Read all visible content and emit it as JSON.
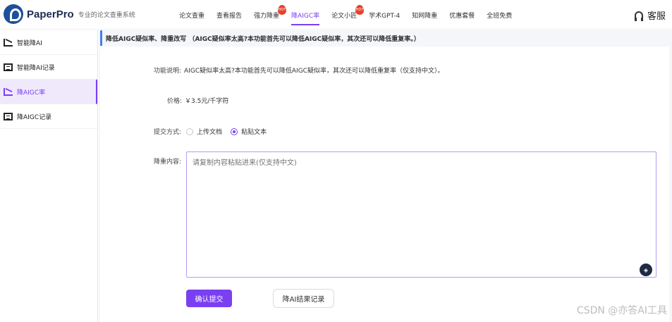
{
  "brand": {
    "name": "PaperPro",
    "slogan": "专业的论文查重系统"
  },
  "nav": {
    "items": [
      {
        "label": "论文查重",
        "hot": false,
        "active": false
      },
      {
        "label": "查看报告",
        "hot": false,
        "active": false
      },
      {
        "label": "强力降重",
        "hot": true,
        "active": false
      },
      {
        "label": "降AIGC率",
        "hot": false,
        "active": true
      },
      {
        "label": "论文小匠",
        "hot": true,
        "active": false
      },
      {
        "label": "学术GPT-4",
        "hot": false,
        "active": false
      },
      {
        "label": "知网降重",
        "hot": false,
        "active": false
      },
      {
        "label": "优惠套餐",
        "hot": false,
        "active": false
      },
      {
        "label": "全班免费",
        "hot": false,
        "active": false
      }
    ],
    "hot_badge": "HOT",
    "service_label": "客服"
  },
  "sidebar": {
    "items": [
      {
        "label": "智能降AI",
        "icon": "chart-icon",
        "active": false
      },
      {
        "label": "智能降AI记录",
        "icon": "document-icon",
        "active": false
      },
      {
        "label": "降AIGC率",
        "icon": "chart-icon",
        "active": true
      },
      {
        "label": "降AIGC记录",
        "icon": "document-icon",
        "active": false
      }
    ]
  },
  "notice": {
    "text": "降低AIGC疑似率、降重改写 （AIGC疑似率太高?本功能首先可以降低AIGC疑似率，其次还可以降低重复率。）"
  },
  "form": {
    "description_label": "功能说明:",
    "description_value": "AIGC疑似率太高?本功能首先可以降低AIGC疑似率，其次还可以降低重复率（仅支持中文）。",
    "price_label": "价格:",
    "price_value": "￥3.5元/千字符",
    "submit_method_label": "提交方式:",
    "submit_options": [
      {
        "label": "上传文档",
        "checked": false
      },
      {
        "label": "粘贴文本",
        "checked": true
      }
    ],
    "content_label": "降重内容:",
    "content_placeholder": "请复制内容粘贴进来(仅支持中文)",
    "content_value": "",
    "submit_button": "确认提交",
    "record_button": "降AI结果记录"
  },
  "colors": {
    "accent": "#7b3ff2",
    "notice_bar": "#4a7cf0",
    "hot": "#e8412c"
  },
  "watermark": "CSDN @亦答AI工具"
}
